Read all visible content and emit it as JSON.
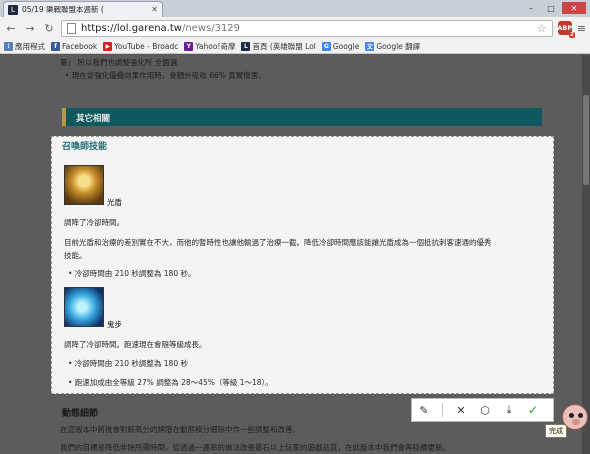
{
  "browser": {
    "tab_title": "05/19 樂戰聯盟本週新 (",
    "tab_favicon": "L",
    "url_host": "https://lol.garena.tw",
    "url_path": "/news/3129",
    "extension_label": "ABP",
    "extension_badge": "2"
  },
  "bookmarks": [
    {
      "label": "應用程式",
      "icon": "apps-icon",
      "color": "#5a7fb8",
      "glyph": "⋮"
    },
    {
      "label": "Facebook",
      "icon": "facebook-icon",
      "color": "#3b5998",
      "glyph": "f"
    },
    {
      "label": "YouTube - Broadc",
      "icon": "youtube-icon",
      "color": "#d62020",
      "glyph": "▶"
    },
    {
      "label": "Yahoo!奇摩",
      "icon": "yahoo-icon",
      "color": "#6a1b9a",
      "glyph": "Y"
    },
    {
      "label": "首頁 (英雄聯盟 Lol",
      "icon": "lol-icon",
      "color": "#1b2a4a",
      "glyph": "L"
    },
    {
      "label": "Google",
      "icon": "google-icon",
      "color": "#4285f4",
      "glyph": "G"
    },
    {
      "label": "Google 翻譯",
      "icon": "translate-icon",
      "color": "#4285f4",
      "glyph": "文"
    }
  ],
  "page": {
    "top_fragment": "量」 所以我們也調整強化所 全面選",
    "top_bullet": "• 現在當強化優疊效果作用時，會額外吸收 66% 真實傷害。",
    "section_title": "其它相關",
    "lower_heading": "動態細節",
    "lower_line_1": "在這版本中將後會對較高分的牌階在動態稿分細除中作一些調整和改善。",
    "lower_line_2": "我們的目標是降低非除所需時間，從透過一連串的做法改善最石以上玩家的遊戲品質，在此版本中我們會再陸續更新。"
  },
  "capture": {
    "heading": "召喚師技能",
    "skills": [
      {
        "name": "光盾",
        "line_1": "調降了冷卻時間。",
        "line_2": "目前光盾和治療的差別實在不大，而他的暫時性也讓他輸過了治療一截。降低冷卻時間應該能讓光盾成為一個抵抗刺客速通的優秀",
        "line_3": "技能。",
        "bullet_1": "• 冷卻時間由 210 秒調整為 180 秒。"
      },
      {
        "name": "鬼步",
        "line_1": "調降了冷卻時間。跑速現在會隨等級成長。",
        "bullet_1": "• 冷卻時間由 210 秒調整為 180 秒",
        "bullet_2": "• 跑速加成由全等級 27% 調整為 28～45%（等級 1～18）。"
      }
    ]
  },
  "snip_toolbar": {
    "pen_icon": "✎",
    "close_icon": "✕",
    "shape_icon": "⬡",
    "save_icon": "⤓",
    "done_icon": "✓",
    "tooltip": "完成"
  }
}
